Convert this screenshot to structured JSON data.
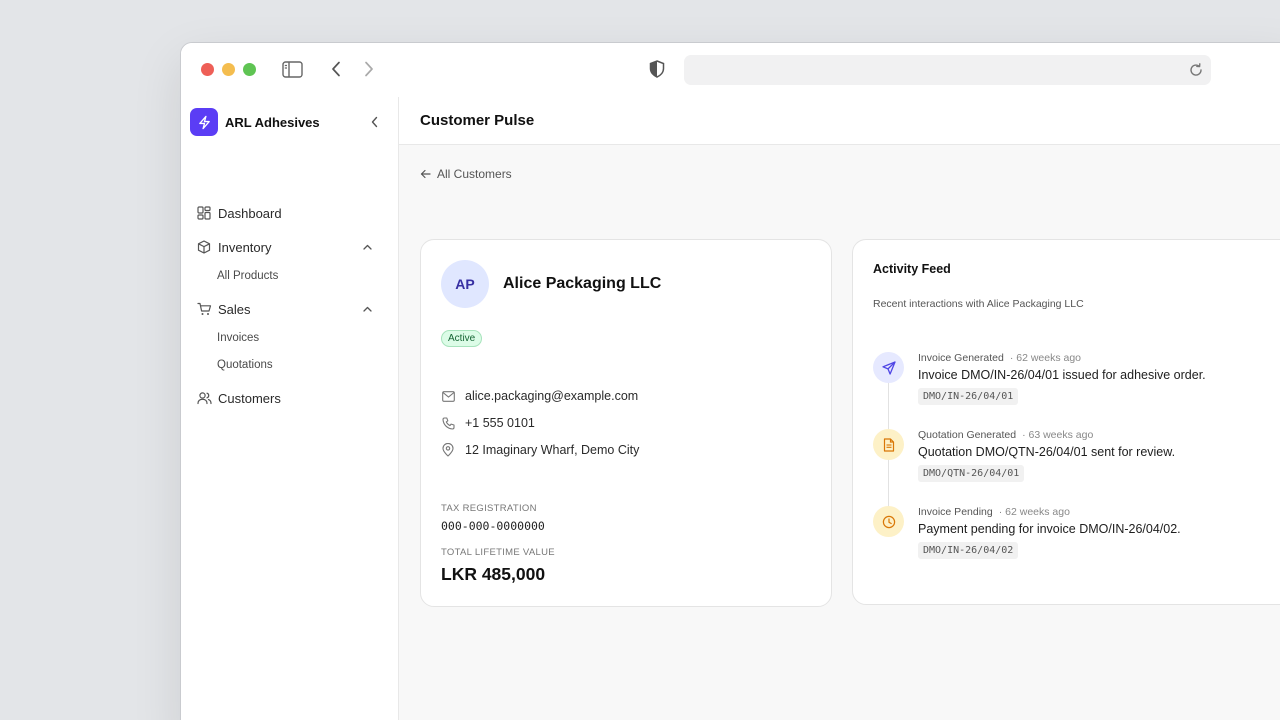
{
  "browser": {
    "url": ""
  },
  "brand": {
    "name": "ARL Adhesives",
    "accent": "#5b3df5"
  },
  "sidebar": {
    "items": [
      {
        "label": "Dashboard",
        "icon": "dashboard-icon"
      },
      {
        "label": "Inventory",
        "icon": "box-icon",
        "expanded": true,
        "children": [
          {
            "label": "All Products"
          }
        ]
      },
      {
        "label": "Sales",
        "icon": "cart-icon",
        "expanded": true,
        "children": [
          {
            "label": "Invoices"
          },
          {
            "label": "Quotations"
          }
        ]
      },
      {
        "label": "Customers",
        "icon": "users-icon"
      }
    ]
  },
  "header": {
    "title": "Customer Pulse"
  },
  "back_link": {
    "label": "All Customers"
  },
  "customer": {
    "initials": "AP",
    "name": "Alice Packaging LLC",
    "status": "Active",
    "email": "alice.packaging@example.com",
    "phone": "+1 555 0101",
    "address": "12 Imaginary Wharf, Demo City",
    "tax_label": "TAX REGISTRATION",
    "tax_value": "000-000-0000000",
    "ltv_label": "TOTAL LIFETIME VALUE",
    "ltv_value": "LKR 485,000"
  },
  "activity": {
    "title": "Activity Feed",
    "subtitle": "Recent interactions with Alice Packaging LLC",
    "items": [
      {
        "event": "Invoice Generated",
        "ago": "· 62 weeks ago",
        "description": "Invoice DMO/IN-26/04/01 issued for adhesive order.",
        "ref": "DMO/IN-26/04/01",
        "icon": "send-icon",
        "color": "#4f46e5"
      },
      {
        "event": "Quotation Generated",
        "ago": "· 63 weeks ago",
        "description": "Quotation DMO/QTN-26/04/01 sent for review.",
        "ref": "DMO/QTN-26/04/01",
        "icon": "document-icon",
        "color": "#d97706"
      },
      {
        "event": "Invoice Pending",
        "ago": "· 62 weeks ago",
        "description": "Payment pending for invoice DMO/IN-26/04/02.",
        "ref": "DMO/IN-26/04/02",
        "icon": "clock-icon",
        "color": "#d97706"
      }
    ]
  }
}
